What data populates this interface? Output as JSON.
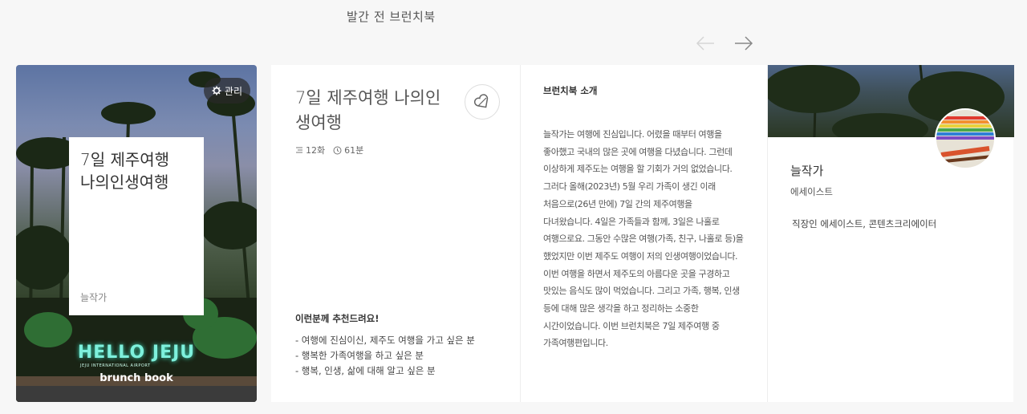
{
  "header": {
    "title": "발간 전 브런치북"
  },
  "nav": {
    "prev_icon": "arrow-left-icon",
    "next_icon": "arrow-right-icon"
  },
  "cover": {
    "manage_label": "관리",
    "title": "7일 제주여행\n나의인생여행",
    "author": "늘작가",
    "sign_text": "HELLO JEJU",
    "airport_text": "JEJU INTERNATIONAL AIRPORT",
    "badge": "brunch book"
  },
  "info": {
    "title": "7일 제주여행 나의인생여행",
    "episodes": "12화",
    "duration": "61분",
    "recommend_title": "이런분께 추천드려요!",
    "recommend_items": [
      "- 여행에 진심이신, 제주도 여행을 가고 싶은 분",
      "- 행복한 가족여행을 하고 싶은 분",
      "- 행복, 인생, 삶에 대해 알고 싶은 분"
    ]
  },
  "intro": {
    "label": "브런치북 소개",
    "body": "늘작가는 여행에 진심입니다. 어렸을 때부터 여행을 좋아했고 국내의 많은 곳에 여행을 다녔습니다. 그런데 이상하게 제주도는 여행을 할 기회가 거의 없었습니다. 그러다 올해(2023년) 5월 우리 가족이 생긴 이래 처음으로(26년 만에) 7일 간의 제주여행을 다녀왔습니다. 4일은 가족들과 함께, 3일은 나홀로 여행으로요. 그동안 수많은 여행(가족, 친구, 나홀로 등)을 했었지만 이번 제주도 여행이 저의 인생여행이었습니다. 이번 여행을 하면서 제주도의 아름다운 곳을 구경하고 맛있는 음식도 많이 먹었습니다. 그리고 가족, 행복, 인생 등에 대해 많은 생각을 하고 정리하는 소중한 시간이었습니다. 이번 브런치북은 7일 제주여행 중 가족여행편입니다."
  },
  "author": {
    "name": "늘작가",
    "job": "에세이스트",
    "description": "직장인 에세이스트, 콘텐츠크리에이터"
  },
  "colors": {
    "background": "#f7f7f7",
    "panel": "#ffffff",
    "sign": "#7ef0dc"
  }
}
